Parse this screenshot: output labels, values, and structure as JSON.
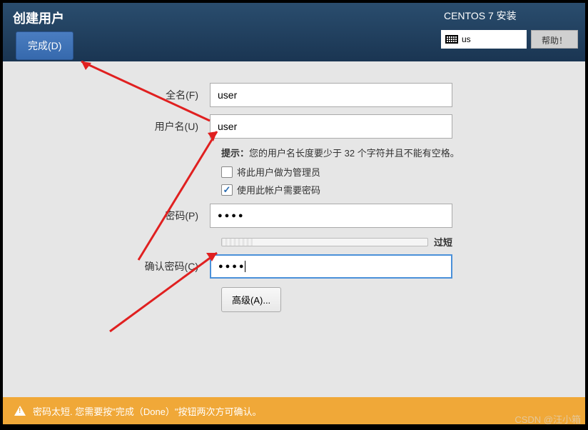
{
  "header": {
    "title": "创建用户",
    "done_button": "完成(D)",
    "install_title": "CENTOS 7 安装",
    "keyboard_layout": "us",
    "help_button": "帮助！"
  },
  "form": {
    "full_name_label": "全名(F)",
    "full_name_value": "user",
    "username_label": "用户名(U)",
    "username_value": "user",
    "hint_prefix": "提示：",
    "hint_text": "您的用户名长度要少于 32 个字符并且不能有空格。",
    "checkbox_admin": "将此用户做为管理员",
    "checkbox_admin_checked": false,
    "checkbox_password": "使用此帐户需要密码",
    "checkbox_password_checked": true,
    "password_label": "密码(P)",
    "password_value": "●●●●",
    "strength_label": "过短",
    "confirm_label": "确认密码(C)",
    "confirm_value": "●●●●",
    "advanced_button": "高级(A)..."
  },
  "warning": {
    "text": "密码太短. 您需要按\"完成（Done）\"按钮两次方可确认。"
  },
  "watermark": "CSDN @汪小箱"
}
